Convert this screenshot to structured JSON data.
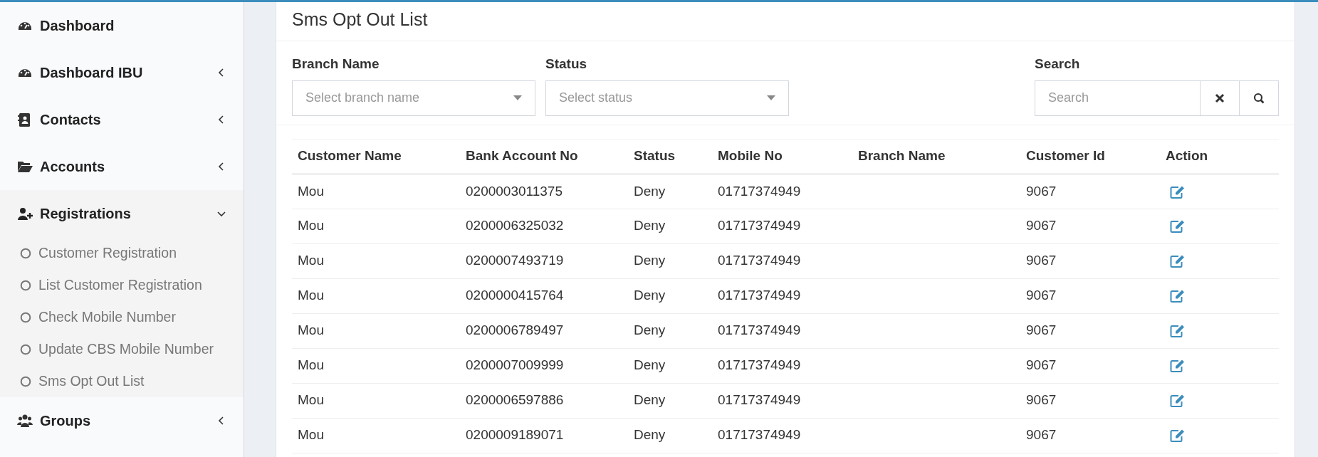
{
  "sidebar": {
    "items": [
      {
        "label": "Dashboard",
        "kind": "link"
      },
      {
        "label": "Dashboard IBU",
        "kind": "group",
        "expanded": false
      },
      {
        "label": "Contacts",
        "kind": "group",
        "expanded": false
      },
      {
        "label": "Accounts",
        "kind": "group",
        "expanded": false
      },
      {
        "label": "Registrations",
        "kind": "group",
        "expanded": true,
        "children": [
          {
            "label": "Customer Registration"
          },
          {
            "label": "List Customer Registration"
          },
          {
            "label": "Check Mobile Number"
          },
          {
            "label": "Update CBS Mobile Number"
          },
          {
            "label": "Sms Opt Out List"
          }
        ]
      },
      {
        "label": "Groups",
        "kind": "group",
        "expanded": false
      }
    ]
  },
  "page_title": "Sms Opt Out List",
  "filters": [
    {
      "label": "Branch Name",
      "placeholder": "Select branch name"
    },
    {
      "label": "Status",
      "placeholder": "Select status"
    }
  ],
  "search": {
    "label": "Search",
    "placeholder": "Search"
  },
  "table": {
    "columns": [
      "Customer Name",
      "Bank Account No",
      "Status",
      "Mobile No",
      "Branch Name",
      "Customer Id",
      "Action"
    ],
    "rows": [
      [
        "Mou",
        "0200003011375",
        "Deny",
        "01717374949",
        "",
        "9067"
      ],
      [
        "Mou",
        "0200006325032",
        "Deny",
        "01717374949",
        "",
        "9067"
      ],
      [
        "Mou",
        "0200007493719",
        "Deny",
        "01717374949",
        "",
        "9067"
      ],
      [
        "Mou",
        "0200000415764",
        "Deny",
        "01717374949",
        "",
        "9067"
      ],
      [
        "Mou",
        "0200006789497",
        "Deny",
        "01717374949",
        "",
        "9067"
      ],
      [
        "Mou",
        "0200007009999",
        "Deny",
        "01717374949",
        "",
        "9067"
      ],
      [
        "Mou",
        "0200006597886",
        "Deny",
        "01717374949",
        "",
        "9067"
      ],
      [
        "Mou",
        "0200009189071",
        "Deny",
        "01717374949",
        "",
        "9067"
      ]
    ]
  }
}
